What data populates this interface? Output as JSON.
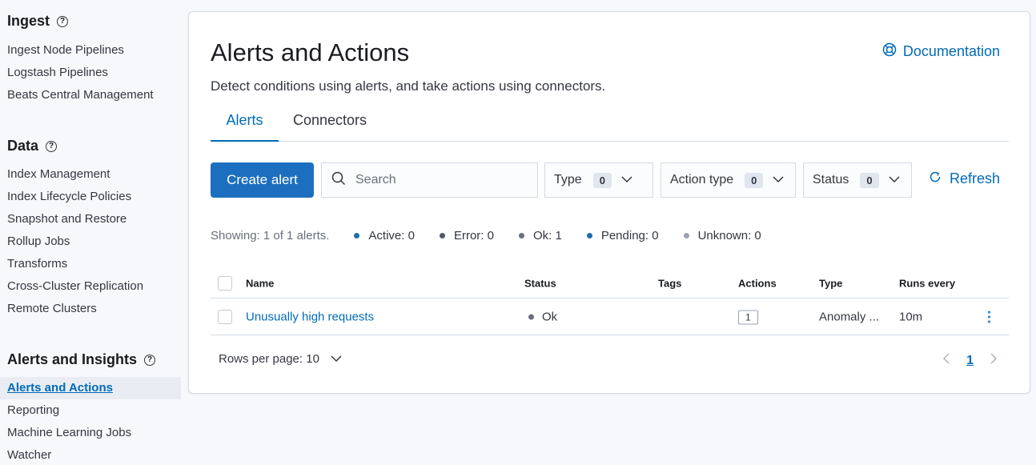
{
  "sidebar": {
    "sections": [
      {
        "title": "Ingest",
        "items": [
          "Ingest Node Pipelines",
          "Logstash Pipelines",
          "Beats Central Management"
        ]
      },
      {
        "title": "Data",
        "items": [
          "Index Management",
          "Index Lifecycle Policies",
          "Snapshot and Restore",
          "Rollup Jobs",
          "Transforms",
          "Cross-Cluster Replication",
          "Remote Clusters"
        ]
      },
      {
        "title": "Alerts and Insights",
        "items": [
          "Alerts and Actions",
          "Reporting",
          "Machine Learning Jobs",
          "Watcher"
        ]
      }
    ],
    "help_glyph": "?"
  },
  "page": {
    "title": "Alerts and Actions",
    "documentation_label": "Documentation",
    "description": "Detect conditions using alerts, and take actions using connectors.",
    "tabs": [
      "Alerts",
      "Connectors"
    ]
  },
  "toolbar": {
    "create_label": "Create alert",
    "search_placeholder": "Search",
    "filters": [
      {
        "label": "Type",
        "count": "0"
      },
      {
        "label": "Action type",
        "count": "0"
      },
      {
        "label": "Status",
        "count": "0"
      }
    ],
    "refresh_label": "Refresh"
  },
  "summary": {
    "showing": "Showing: 1 of 1 alerts.",
    "stats": [
      {
        "label": "Active: 0",
        "color": "#1f6cb0"
      },
      {
        "label": "Error: 0",
        "color": "#535966"
      },
      {
        "label": "Ok: 1",
        "color": "#69707d"
      },
      {
        "label": "Pending: 0",
        "color": "#1f6cb0"
      },
      {
        "label": "Unknown: 0",
        "color": "#98a2b3"
      }
    ]
  },
  "table": {
    "headers": {
      "name": "Name",
      "status": "Status",
      "tags": "Tags",
      "actions": "Actions",
      "type": "Type",
      "runs": "Runs every"
    },
    "rows": [
      {
        "name": "Unusually high requests",
        "status": "Ok",
        "actions": "1",
        "type": "Anomaly ...",
        "runs": "10m"
      }
    ]
  },
  "footer": {
    "rows_per_page": "Rows per page: 10",
    "current_page": "1"
  },
  "colors": {
    "accent": "#006bb8",
    "primary_button": "#1c6fbe"
  }
}
